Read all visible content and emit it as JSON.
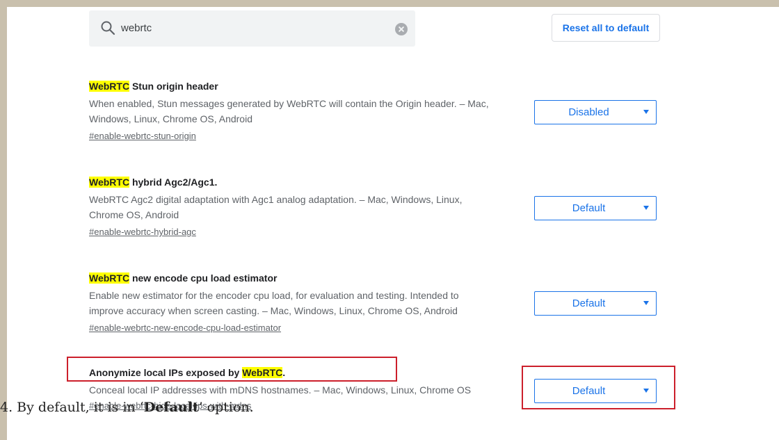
{
  "search": {
    "query": "webrtc"
  },
  "toolbar": {
    "reset_label": "Reset all to default"
  },
  "experiments": [
    {
      "highlight": "WebRTC",
      "title_rest": " Stun origin header",
      "description_line1": "When enabled, Stun messages generated by WebRTC will contain the Origin header. – Mac,",
      "description_line2": "Windows, Linux, Chrome OS, Android",
      "link": "#enable-webrtc-stun-origin",
      "selected": "Disabled"
    },
    {
      "highlight": "WebRTC",
      "title_rest": " hybrid Agc2/Agc1.",
      "description_line1": "WebRTC Agc2 digital adaptation with Agc1 analog adaptation. – Mac, Windows, Linux,",
      "description_line2": "Chrome OS, Android",
      "link": "#enable-webrtc-hybrid-agc",
      "selected": "Default"
    },
    {
      "highlight": "WebRTC",
      "title_rest": " new encode cpu load estimator",
      "description_line1": "Enable new estimator for the encoder cpu load, for evaluation and testing. Intended to",
      "description_line2": "improve accuracy when screen casting. – Mac, Windows, Linux, Chrome OS, Android",
      "link": "#enable-webrtc-new-encode-cpu-load-estimator",
      "selected": "Default"
    },
    {
      "title_prefix": "Anonymize local IPs exposed by ",
      "highlight": "WebRTC",
      "title_suffix": ".",
      "description_line1": "Conceal local IP addresses with mDNS hostnames. – Mac, Windows, Linux, Chrome OS",
      "link": "#enable-webrtc-hide-local-ips-with-mdns",
      "selected": "Default"
    }
  ],
  "caption": {
    "prefix": "4. By default, it is in ‘",
    "bold": "Default",
    "suffix": "’ option."
  },
  "colors": {
    "accent": "#1a73e8",
    "highlight": "#ffff00",
    "annotation_red": "#cc1f2b"
  }
}
